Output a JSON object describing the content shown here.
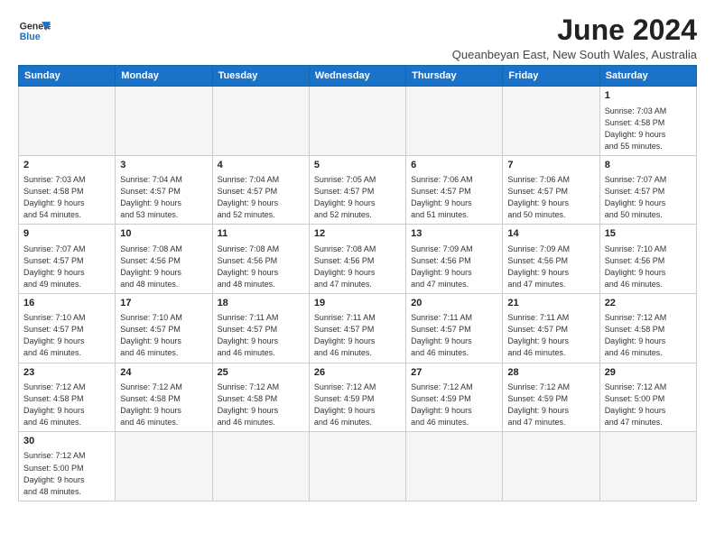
{
  "header": {
    "logo_line1": "General",
    "logo_line2": "Blue",
    "month_title": "June 2024",
    "subtitle": "Queanbeyan East, New South Wales, Australia"
  },
  "weekdays": [
    "Sunday",
    "Monday",
    "Tuesday",
    "Wednesday",
    "Thursday",
    "Friday",
    "Saturday"
  ],
  "weeks": [
    [
      {
        "day": "",
        "info": ""
      },
      {
        "day": "",
        "info": ""
      },
      {
        "day": "",
        "info": ""
      },
      {
        "day": "",
        "info": ""
      },
      {
        "day": "",
        "info": ""
      },
      {
        "day": "",
        "info": ""
      },
      {
        "day": "1",
        "info": "Sunrise: 7:03 AM\nSunset: 4:58 PM\nDaylight: 9 hours\nand 55 minutes."
      }
    ],
    [
      {
        "day": "2",
        "info": "Sunrise: 7:03 AM\nSunset: 4:58 PM\nDaylight: 9 hours\nand 54 minutes."
      },
      {
        "day": "3",
        "info": "Sunrise: 7:04 AM\nSunset: 4:57 PM\nDaylight: 9 hours\nand 53 minutes."
      },
      {
        "day": "4",
        "info": "Sunrise: 7:04 AM\nSunset: 4:57 PM\nDaylight: 9 hours\nand 52 minutes."
      },
      {
        "day": "5",
        "info": "Sunrise: 7:05 AM\nSunset: 4:57 PM\nDaylight: 9 hours\nand 52 minutes."
      },
      {
        "day": "6",
        "info": "Sunrise: 7:06 AM\nSunset: 4:57 PM\nDaylight: 9 hours\nand 51 minutes."
      },
      {
        "day": "7",
        "info": "Sunrise: 7:06 AM\nSunset: 4:57 PM\nDaylight: 9 hours\nand 50 minutes."
      },
      {
        "day": "8",
        "info": "Sunrise: 7:07 AM\nSunset: 4:57 PM\nDaylight: 9 hours\nand 50 minutes."
      }
    ],
    [
      {
        "day": "9",
        "info": "Sunrise: 7:07 AM\nSunset: 4:57 PM\nDaylight: 9 hours\nand 49 minutes."
      },
      {
        "day": "10",
        "info": "Sunrise: 7:08 AM\nSunset: 4:56 PM\nDaylight: 9 hours\nand 48 minutes."
      },
      {
        "day": "11",
        "info": "Sunrise: 7:08 AM\nSunset: 4:56 PM\nDaylight: 9 hours\nand 48 minutes."
      },
      {
        "day": "12",
        "info": "Sunrise: 7:08 AM\nSunset: 4:56 PM\nDaylight: 9 hours\nand 47 minutes."
      },
      {
        "day": "13",
        "info": "Sunrise: 7:09 AM\nSunset: 4:56 PM\nDaylight: 9 hours\nand 47 minutes."
      },
      {
        "day": "14",
        "info": "Sunrise: 7:09 AM\nSunset: 4:56 PM\nDaylight: 9 hours\nand 47 minutes."
      },
      {
        "day": "15",
        "info": "Sunrise: 7:10 AM\nSunset: 4:56 PM\nDaylight: 9 hours\nand 46 minutes."
      }
    ],
    [
      {
        "day": "16",
        "info": "Sunrise: 7:10 AM\nSunset: 4:57 PM\nDaylight: 9 hours\nand 46 minutes."
      },
      {
        "day": "17",
        "info": "Sunrise: 7:10 AM\nSunset: 4:57 PM\nDaylight: 9 hours\nand 46 minutes."
      },
      {
        "day": "18",
        "info": "Sunrise: 7:11 AM\nSunset: 4:57 PM\nDaylight: 9 hours\nand 46 minutes."
      },
      {
        "day": "19",
        "info": "Sunrise: 7:11 AM\nSunset: 4:57 PM\nDaylight: 9 hours\nand 46 minutes."
      },
      {
        "day": "20",
        "info": "Sunrise: 7:11 AM\nSunset: 4:57 PM\nDaylight: 9 hours\nand 46 minutes."
      },
      {
        "day": "21",
        "info": "Sunrise: 7:11 AM\nSunset: 4:57 PM\nDaylight: 9 hours\nand 46 minutes."
      },
      {
        "day": "22",
        "info": "Sunrise: 7:12 AM\nSunset: 4:58 PM\nDaylight: 9 hours\nand 46 minutes."
      }
    ],
    [
      {
        "day": "23",
        "info": "Sunrise: 7:12 AM\nSunset: 4:58 PM\nDaylight: 9 hours\nand 46 minutes."
      },
      {
        "day": "24",
        "info": "Sunrise: 7:12 AM\nSunset: 4:58 PM\nDaylight: 9 hours\nand 46 minutes."
      },
      {
        "day": "25",
        "info": "Sunrise: 7:12 AM\nSunset: 4:58 PM\nDaylight: 9 hours\nand 46 minutes."
      },
      {
        "day": "26",
        "info": "Sunrise: 7:12 AM\nSunset: 4:59 PM\nDaylight: 9 hours\nand 46 minutes."
      },
      {
        "day": "27",
        "info": "Sunrise: 7:12 AM\nSunset: 4:59 PM\nDaylight: 9 hours\nand 46 minutes."
      },
      {
        "day": "28",
        "info": "Sunrise: 7:12 AM\nSunset: 4:59 PM\nDaylight: 9 hours\nand 47 minutes."
      },
      {
        "day": "29",
        "info": "Sunrise: 7:12 AM\nSunset: 5:00 PM\nDaylight: 9 hours\nand 47 minutes."
      }
    ],
    [
      {
        "day": "30",
        "info": "Sunrise: 7:12 AM\nSunset: 5:00 PM\nDaylight: 9 hours\nand 48 minutes."
      },
      {
        "day": "",
        "info": ""
      },
      {
        "day": "",
        "info": ""
      },
      {
        "day": "",
        "info": ""
      },
      {
        "day": "",
        "info": ""
      },
      {
        "day": "",
        "info": ""
      },
      {
        "day": "",
        "info": ""
      }
    ]
  ]
}
